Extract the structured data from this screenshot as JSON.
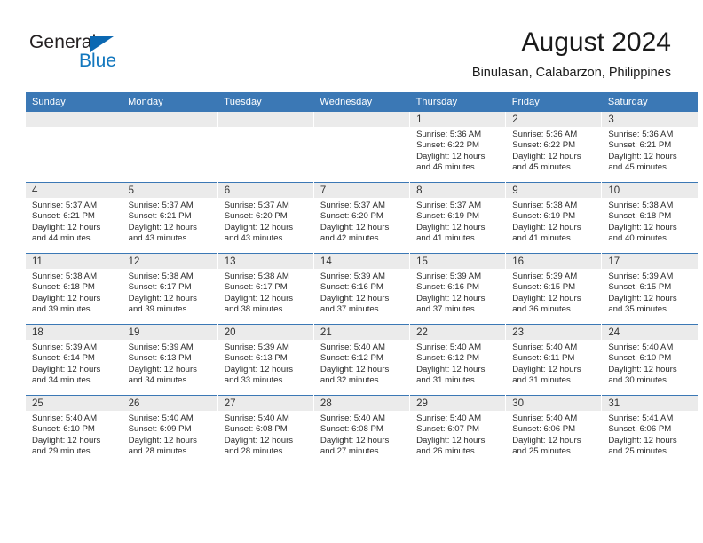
{
  "brand": {
    "name_part1": "General",
    "name_part2": "Blue",
    "triangle_icon": "triangle-logo-icon",
    "accent_color": "#1277be"
  },
  "header": {
    "title": "August 2024",
    "subtitle": "Binulasan, Calabarzon, Philippines"
  },
  "theme": {
    "header_row_bg": "#3b78b5",
    "daynum_band_bg": "#ebebeb",
    "cell_bg": "#ffffff",
    "grid_line": "#3b78b5",
    "text": "#2b2b2b"
  },
  "weekday_headers": [
    "Sunday",
    "Monday",
    "Tuesday",
    "Wednesday",
    "Thursday",
    "Friday",
    "Saturday"
  ],
  "labels": {
    "sunrise_prefix": "Sunrise:",
    "sunset_prefix": "Sunset:",
    "daylight_prefix": "Daylight:"
  },
  "weeks": [
    [
      {
        "day": "",
        "blank": true
      },
      {
        "day": "",
        "blank": true
      },
      {
        "day": "",
        "blank": true
      },
      {
        "day": "",
        "blank": true
      },
      {
        "day": "1",
        "sunrise": "Sunrise: 5:36 AM",
        "sunset": "Sunset: 6:22 PM",
        "daylight": "Daylight: 12 hours and 46 minutes."
      },
      {
        "day": "2",
        "sunrise": "Sunrise: 5:36 AM",
        "sunset": "Sunset: 6:22 PM",
        "daylight": "Daylight: 12 hours and 45 minutes."
      },
      {
        "day": "3",
        "sunrise": "Sunrise: 5:36 AM",
        "sunset": "Sunset: 6:21 PM",
        "daylight": "Daylight: 12 hours and 45 minutes."
      }
    ],
    [
      {
        "day": "4",
        "sunrise": "Sunrise: 5:37 AM",
        "sunset": "Sunset: 6:21 PM",
        "daylight": "Daylight: 12 hours and 44 minutes."
      },
      {
        "day": "5",
        "sunrise": "Sunrise: 5:37 AM",
        "sunset": "Sunset: 6:21 PM",
        "daylight": "Daylight: 12 hours and 43 minutes."
      },
      {
        "day": "6",
        "sunrise": "Sunrise: 5:37 AM",
        "sunset": "Sunset: 6:20 PM",
        "daylight": "Daylight: 12 hours and 43 minutes."
      },
      {
        "day": "7",
        "sunrise": "Sunrise: 5:37 AM",
        "sunset": "Sunset: 6:20 PM",
        "daylight": "Daylight: 12 hours and 42 minutes."
      },
      {
        "day": "8",
        "sunrise": "Sunrise: 5:37 AM",
        "sunset": "Sunset: 6:19 PM",
        "daylight": "Daylight: 12 hours and 41 minutes."
      },
      {
        "day": "9",
        "sunrise": "Sunrise: 5:38 AM",
        "sunset": "Sunset: 6:19 PM",
        "daylight": "Daylight: 12 hours and 41 minutes."
      },
      {
        "day": "10",
        "sunrise": "Sunrise: 5:38 AM",
        "sunset": "Sunset: 6:18 PM",
        "daylight": "Daylight: 12 hours and 40 minutes."
      }
    ],
    [
      {
        "day": "11",
        "sunrise": "Sunrise: 5:38 AM",
        "sunset": "Sunset: 6:18 PM",
        "daylight": "Daylight: 12 hours and 39 minutes."
      },
      {
        "day": "12",
        "sunrise": "Sunrise: 5:38 AM",
        "sunset": "Sunset: 6:17 PM",
        "daylight": "Daylight: 12 hours and 39 minutes."
      },
      {
        "day": "13",
        "sunrise": "Sunrise: 5:38 AM",
        "sunset": "Sunset: 6:17 PM",
        "daylight": "Daylight: 12 hours and 38 minutes."
      },
      {
        "day": "14",
        "sunrise": "Sunrise: 5:39 AM",
        "sunset": "Sunset: 6:16 PM",
        "daylight": "Daylight: 12 hours and 37 minutes."
      },
      {
        "day": "15",
        "sunrise": "Sunrise: 5:39 AM",
        "sunset": "Sunset: 6:16 PM",
        "daylight": "Daylight: 12 hours and 37 minutes."
      },
      {
        "day": "16",
        "sunrise": "Sunrise: 5:39 AM",
        "sunset": "Sunset: 6:15 PM",
        "daylight": "Daylight: 12 hours and 36 minutes."
      },
      {
        "day": "17",
        "sunrise": "Sunrise: 5:39 AM",
        "sunset": "Sunset: 6:15 PM",
        "daylight": "Daylight: 12 hours and 35 minutes."
      }
    ],
    [
      {
        "day": "18",
        "sunrise": "Sunrise: 5:39 AM",
        "sunset": "Sunset: 6:14 PM",
        "daylight": "Daylight: 12 hours and 34 minutes."
      },
      {
        "day": "19",
        "sunrise": "Sunrise: 5:39 AM",
        "sunset": "Sunset: 6:13 PM",
        "daylight": "Daylight: 12 hours and 34 minutes."
      },
      {
        "day": "20",
        "sunrise": "Sunrise: 5:39 AM",
        "sunset": "Sunset: 6:13 PM",
        "daylight": "Daylight: 12 hours and 33 minutes."
      },
      {
        "day": "21",
        "sunrise": "Sunrise: 5:40 AM",
        "sunset": "Sunset: 6:12 PM",
        "daylight": "Daylight: 12 hours and 32 minutes."
      },
      {
        "day": "22",
        "sunrise": "Sunrise: 5:40 AM",
        "sunset": "Sunset: 6:12 PM",
        "daylight": "Daylight: 12 hours and 31 minutes."
      },
      {
        "day": "23",
        "sunrise": "Sunrise: 5:40 AM",
        "sunset": "Sunset: 6:11 PM",
        "daylight": "Daylight: 12 hours and 31 minutes."
      },
      {
        "day": "24",
        "sunrise": "Sunrise: 5:40 AM",
        "sunset": "Sunset: 6:10 PM",
        "daylight": "Daylight: 12 hours and 30 minutes."
      }
    ],
    [
      {
        "day": "25",
        "sunrise": "Sunrise: 5:40 AM",
        "sunset": "Sunset: 6:10 PM",
        "daylight": "Daylight: 12 hours and 29 minutes."
      },
      {
        "day": "26",
        "sunrise": "Sunrise: 5:40 AM",
        "sunset": "Sunset: 6:09 PM",
        "daylight": "Daylight: 12 hours and 28 minutes."
      },
      {
        "day": "27",
        "sunrise": "Sunrise: 5:40 AM",
        "sunset": "Sunset: 6:08 PM",
        "daylight": "Daylight: 12 hours and 28 minutes."
      },
      {
        "day": "28",
        "sunrise": "Sunrise: 5:40 AM",
        "sunset": "Sunset: 6:08 PM",
        "daylight": "Daylight: 12 hours and 27 minutes."
      },
      {
        "day": "29",
        "sunrise": "Sunrise: 5:40 AM",
        "sunset": "Sunset: 6:07 PM",
        "daylight": "Daylight: 12 hours and 26 minutes."
      },
      {
        "day": "30",
        "sunrise": "Sunrise: 5:40 AM",
        "sunset": "Sunset: 6:06 PM",
        "daylight": "Daylight: 12 hours and 25 minutes."
      },
      {
        "day": "31",
        "sunrise": "Sunrise: 5:41 AM",
        "sunset": "Sunset: 6:06 PM",
        "daylight": "Daylight: 12 hours and 25 minutes."
      }
    ]
  ]
}
